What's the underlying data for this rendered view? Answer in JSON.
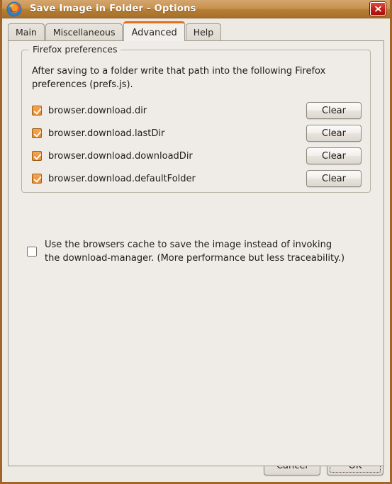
{
  "window": {
    "title": "Save Image in Folder - Options",
    "app_icon": "firefox-icon",
    "close_label": "✕",
    "frame_color": "#a3642a",
    "titlebar_color": "#b57e35"
  },
  "tabs": [
    {
      "label": "Main",
      "selected": false
    },
    {
      "label": "Miscellaneous",
      "selected": false
    },
    {
      "label": "Advanced",
      "selected": true
    },
    {
      "label": "Help",
      "selected": false
    }
  ],
  "accent_color": "#e2701a",
  "group": {
    "title": "Firefox preferences",
    "description": "After saving to a folder write that path into the following Firefox preferences (prefs.js).",
    "rows": [
      {
        "label": "browser.download.dir",
        "checked": true,
        "button": "Clear"
      },
      {
        "label": "browser.download.lastDir",
        "checked": true,
        "button": "Clear"
      },
      {
        "label": "browser.download.downloadDir",
        "checked": true,
        "button": "Clear"
      },
      {
        "label": "browser.download.defaultFolder",
        "checked": true,
        "button": "Clear"
      }
    ]
  },
  "cache_option": {
    "label": "Use the browsers cache to save the image instead of invoking the download-manager. (More performance but less traceability.)",
    "checked": false
  },
  "footer": {
    "cancel_label": "Cancel",
    "ok_label": "OK"
  }
}
